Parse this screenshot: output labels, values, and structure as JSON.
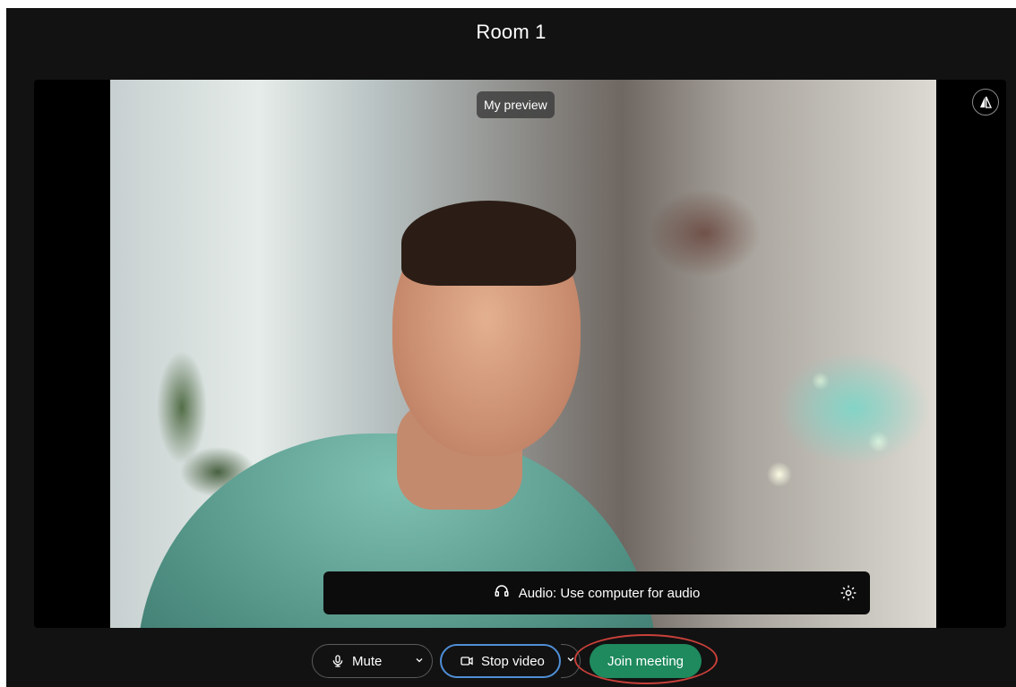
{
  "window": {
    "title": "Room 1"
  },
  "preview": {
    "label": "My preview",
    "corner_icon": "layout-toggle-icon"
  },
  "audio": {
    "text": "Audio: Use computer for audio",
    "icon": "headset-icon",
    "settings_icon": "gear-icon"
  },
  "controls": {
    "mute_label": "Mute",
    "stop_video_label": "Stop video",
    "join_label": "Join meeting"
  },
  "colors": {
    "background": "#121212",
    "join_green": "#1e8a5e",
    "focus_blue": "#4f8fd6",
    "annotation_red": "#c9403a"
  }
}
